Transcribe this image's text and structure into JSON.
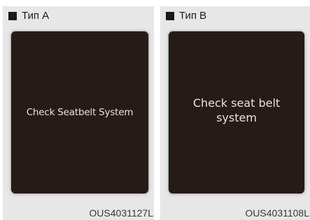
{
  "panels": [
    {
      "type_label": "Тип A",
      "message": "Check Seatbelt System",
      "image_code": "OUS4031127L"
    },
    {
      "type_label": "Тип B",
      "message": "Check seat belt system",
      "image_code": "OUS4031108L"
    }
  ],
  "colors": {
    "panel_background": "#e7e7e7",
    "screen_background": "#251b17",
    "screen_text": "#e8e3dc"
  }
}
